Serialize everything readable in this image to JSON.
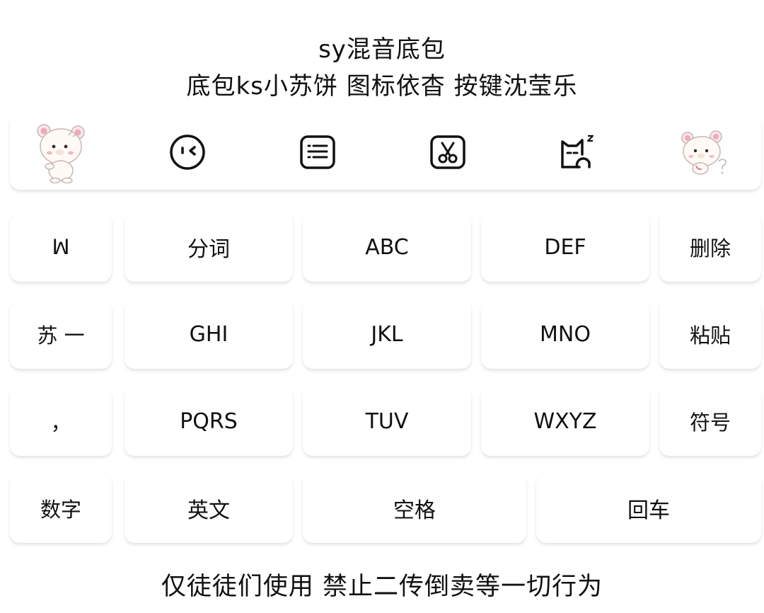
{
  "header": {
    "line1": "sy混音底包",
    "line2": "底包ks小苏饼 图标依杳 按键沈莹乐"
  },
  "toolbar": {
    "icons": [
      "bear-sticker-icon",
      "wink-face-icon",
      "keyboard-icon",
      "scissors-icon",
      "sleepy-cat-icon",
      "bear-sticker-icon"
    ]
  },
  "keyboard": {
    "row1": [
      "ꟽ",
      "分词",
      "ABC",
      "DEF",
      "删除"
    ],
    "row2": [
      "苏 一",
      "GHI",
      "JKL",
      "MNO",
      "粘贴"
    ],
    "row3": [
      "，",
      "PQRS",
      "TUV",
      "WXYZ",
      "符号"
    ],
    "row4": [
      "数字",
      "英文",
      "空格",
      "回车"
    ]
  },
  "footer": {
    "text": "仅徒徒们使用 禁止二传倒卖等一切行为"
  }
}
